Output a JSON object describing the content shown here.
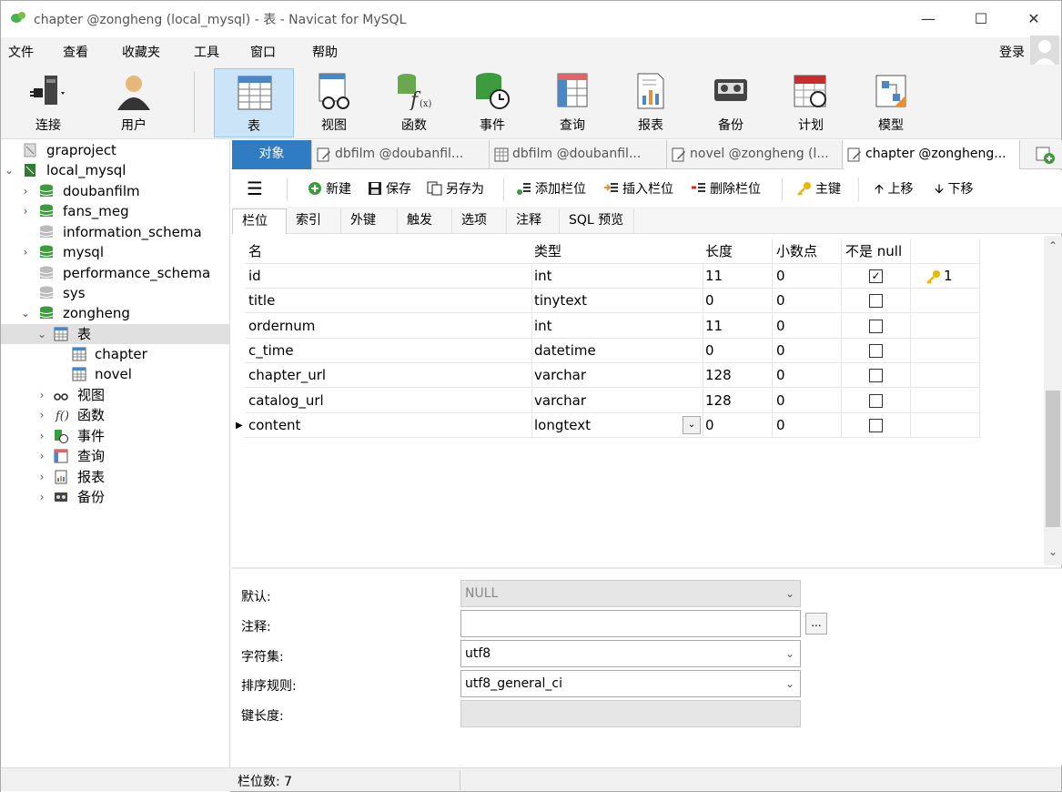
{
  "window": {
    "title": "chapter @zongheng (local_mysql) - 表 - Navicat for MySQL"
  },
  "menu": {
    "items": [
      "文件",
      "查看",
      "收藏夹",
      "工具",
      "窗口",
      "帮助"
    ],
    "login": "登录"
  },
  "toolbar": {
    "items": [
      {
        "label": "连接",
        "icon": "connection-icon"
      },
      {
        "label": "用户",
        "icon": "user-icon"
      },
      {
        "label": "表",
        "icon": "table-icon",
        "active": true
      },
      {
        "label": "视图",
        "icon": "view-icon"
      },
      {
        "label": "函数",
        "icon": "function-icon"
      },
      {
        "label": "事件",
        "icon": "event-icon"
      },
      {
        "label": "查询",
        "icon": "query-icon"
      },
      {
        "label": "报表",
        "icon": "report-icon"
      },
      {
        "label": "备份",
        "icon": "backup-icon"
      },
      {
        "label": "计划",
        "icon": "schedule-icon"
      },
      {
        "label": "模型",
        "icon": "model-icon"
      }
    ]
  },
  "sidebar": {
    "items": [
      {
        "label": "graproject"
      },
      {
        "label": "local_mysql"
      },
      {
        "label": "doubanfilm"
      },
      {
        "label": "fans_meg"
      },
      {
        "label": "information_schema"
      },
      {
        "label": "mysql"
      },
      {
        "label": "performance_schema"
      },
      {
        "label": "sys"
      },
      {
        "label": "zongheng"
      },
      {
        "label": "表"
      },
      {
        "label": "chapter"
      },
      {
        "label": "novel"
      },
      {
        "label": "视图"
      },
      {
        "label": "函数"
      },
      {
        "label": "事件"
      },
      {
        "label": "查询"
      },
      {
        "label": "报表"
      },
      {
        "label": "备份"
      }
    ]
  },
  "doc_tabs": [
    "对象",
    "dbfilm @doubanfil...",
    "dbfilm @doubanfil...",
    "novel @zongheng (l...",
    "chapter @zongheng..."
  ],
  "actions": {
    "menu_icon": "hamburger-icon",
    "new": "新建",
    "save": "保存",
    "save_as": "另存为",
    "add_field": "添加栏位",
    "insert_field": "插入栏位",
    "delete_field": "删除栏位",
    "primary_key": "主键",
    "move_up": "上移",
    "move_down": "下移"
  },
  "sub_tabs": [
    "栏位",
    "索引",
    "外键",
    "触发器",
    "选项",
    "注释",
    "SQL 预览"
  ],
  "grid": {
    "headers": [
      "名",
      "类型",
      "长度",
      "小数点",
      "不是 null",
      ""
    ],
    "rows": [
      {
        "name": "id",
        "type": "int",
        "length": "11",
        "decimals": "0",
        "not_null": true,
        "key": "1"
      },
      {
        "name": "title",
        "type": "tinytext",
        "length": "0",
        "decimals": "0",
        "not_null": false,
        "key": ""
      },
      {
        "name": "ordernum",
        "type": "int",
        "length": "11",
        "decimals": "0",
        "not_null": false,
        "key": ""
      },
      {
        "name": "c_time",
        "type": "datetime",
        "length": "0",
        "decimals": "0",
        "not_null": false,
        "key": ""
      },
      {
        "name": "chapter_url",
        "type": "varchar",
        "length": "128",
        "decimals": "0",
        "not_null": false,
        "key": ""
      },
      {
        "name": "catalog_url",
        "type": "varchar",
        "length": "128",
        "decimals": "0",
        "not_null": false,
        "key": ""
      },
      {
        "name": "content",
        "type": "longtext",
        "length": "0",
        "decimals": "0",
        "not_null": false,
        "key": ""
      }
    ]
  },
  "props": {
    "default_label": "默认:",
    "default_value": "NULL",
    "comment_label": "注释:",
    "comment_value": "",
    "charset_label": "字符集:",
    "charset_value": "utf8",
    "collation_label": "排序规则:",
    "collation_value": "utf8_general_ci",
    "keylen_label": "键长度:",
    "keylen_value": ""
  },
  "status": {
    "field_count": "栏位数: 7"
  }
}
